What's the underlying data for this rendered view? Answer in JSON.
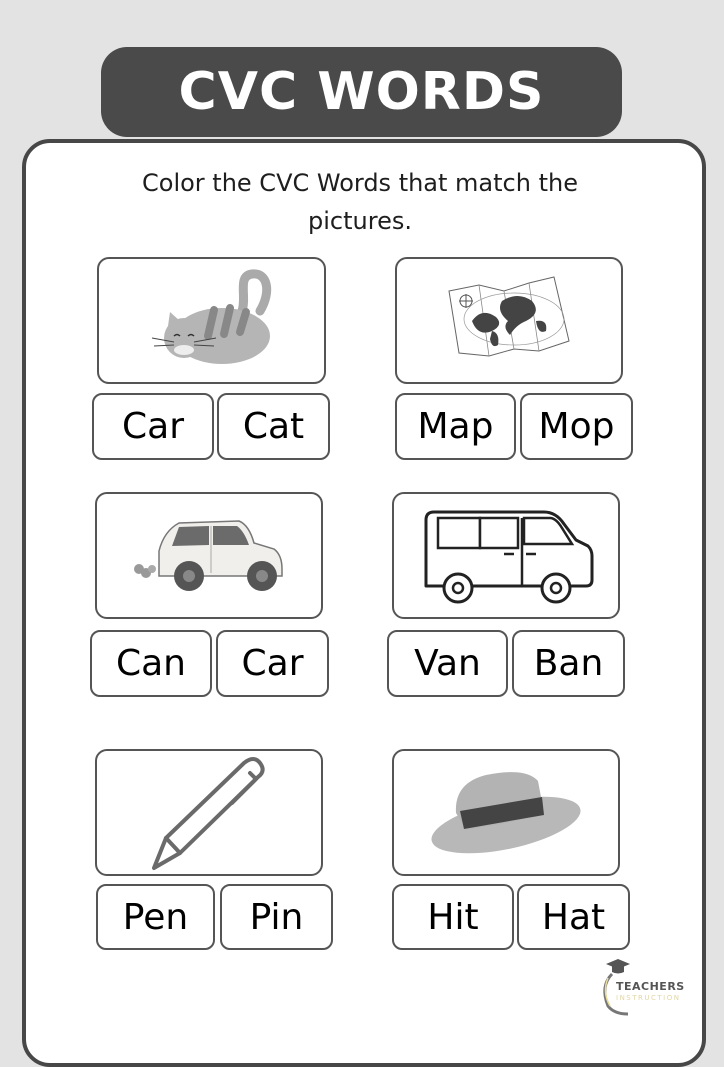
{
  "header": {
    "title": "CVC WORDS"
  },
  "instruction": "Color the CVC Words that match the pictures.",
  "cards": [
    {
      "picture": "cat",
      "options": [
        "Car",
        "Cat"
      ]
    },
    {
      "picture": "map",
      "options": [
        "Map",
        "Mop"
      ]
    },
    {
      "picture": "car",
      "options": [
        "Can",
        "Car"
      ]
    },
    {
      "picture": "van",
      "options": [
        "Van",
        "Ban"
      ]
    },
    {
      "picture": "pen",
      "options": [
        "Pen",
        "Pin"
      ]
    },
    {
      "picture": "hat",
      "options": [
        "Hit",
        "Hat"
      ]
    }
  ],
  "logo": {
    "line1": "TEACHERS",
    "line2": "INSTRUCTION"
  },
  "colors": {
    "title_bg": "#4a4a4a",
    "frame_border": "#474747",
    "page_bg": "#e3e3e3"
  }
}
